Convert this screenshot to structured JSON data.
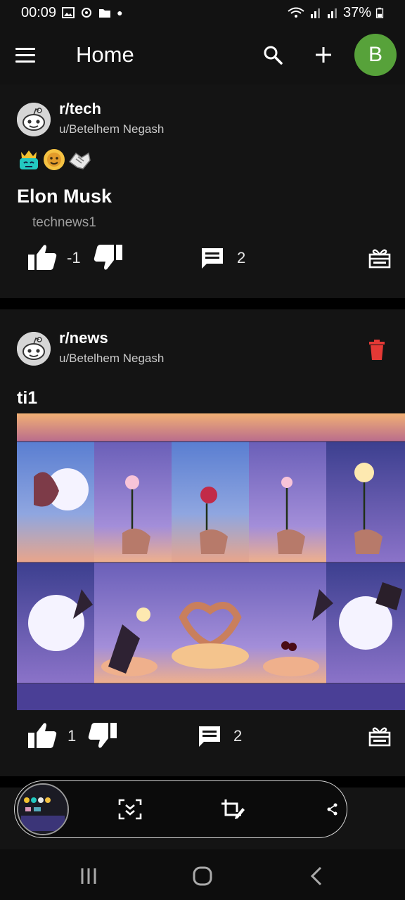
{
  "status": {
    "time": "00:09",
    "battery": "37%"
  },
  "app_bar": {
    "title": "Home",
    "avatar_letter": "B",
    "avatar_color": "#57a23a"
  },
  "posts": [
    {
      "subreddit": "r/tech",
      "user": "u/Betelhem Negash",
      "awards": [
        "crown-award-icon",
        "sunny-award-icon",
        "handshake-award-icon"
      ],
      "title": "Elon Musk",
      "body": "technews1",
      "score": "-1",
      "comments": "2"
    },
    {
      "subreddit": "r/news",
      "user": "u/Betelhem Negash",
      "title": "ti1",
      "score": "1",
      "comments": "2",
      "delete_color": "#e53935"
    }
  ],
  "colors": {
    "background": "#000000",
    "card": "#141414",
    "accent_green": "#57a23a",
    "delete_red": "#e53935"
  }
}
